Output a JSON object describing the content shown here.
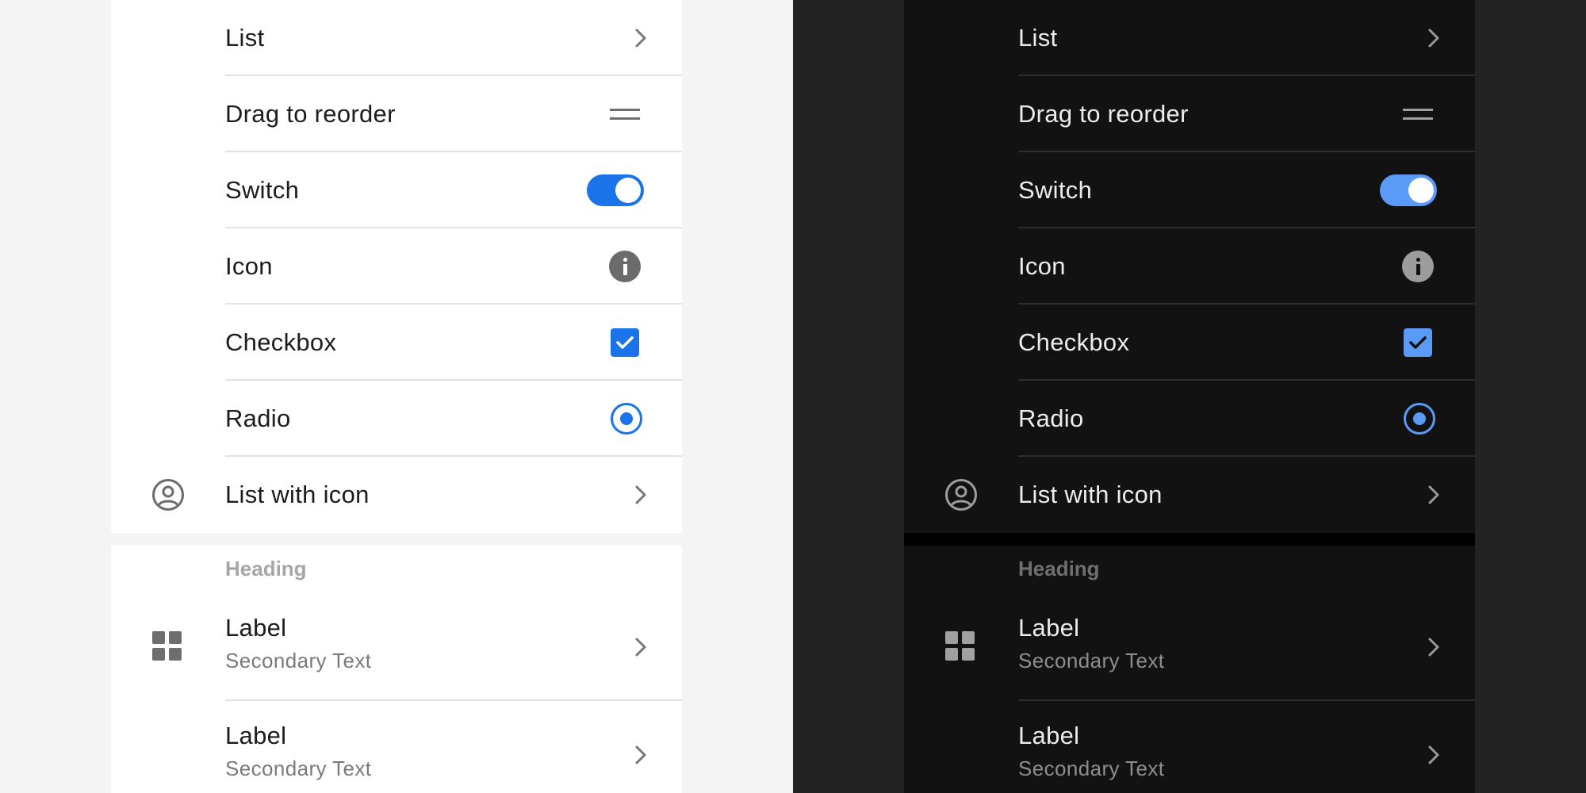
{
  "list_rows": [
    {
      "label": "List",
      "control": "chevron"
    },
    {
      "label": "Drag to reorder",
      "control": "drag-handle"
    },
    {
      "label": "Switch",
      "control": "switch",
      "checked": true
    },
    {
      "label": "Icon",
      "control": "info-icon"
    },
    {
      "label": "Checkbox",
      "control": "checkbox",
      "checked": true
    },
    {
      "label": "Radio",
      "control": "radio",
      "selected": true
    },
    {
      "label": "List with icon",
      "control": "chevron",
      "leading_icon": "account-circle-icon"
    }
  ],
  "section": {
    "heading": "Heading",
    "items": [
      {
        "label": "Label",
        "secondary": "Secondary Text",
        "leading_icon": "grid-icon"
      },
      {
        "label": "Label",
        "secondary": "Secondary Text"
      }
    ]
  },
  "themes": {
    "light": {
      "background": "#f4f4f4",
      "surface": "#ffffff",
      "accent": "#1a73e8"
    },
    "dark": {
      "background": "#232323",
      "surface": "#121212",
      "accent": "#5b9bf8"
    }
  }
}
